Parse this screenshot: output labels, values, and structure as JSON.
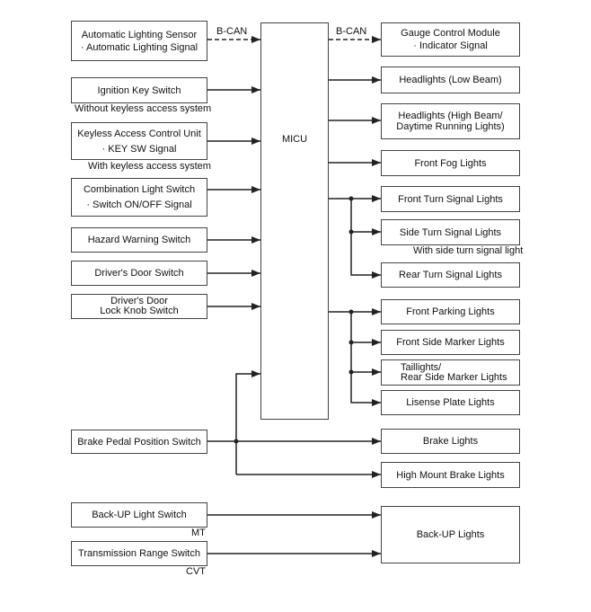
{
  "micu": "MICU",
  "bcan_in": "B-CAN",
  "bcan_out": "B-CAN",
  "inputs": {
    "auto_sensor": [
      "Automatic Lighting Sensor",
      "· Automatic Lighting Signal"
    ],
    "ignition": "Ignition Key Switch",
    "ignition_note": "Without keyless access system",
    "keyless": [
      "Keyless Access Control Unit",
      "· KEY SW Signal"
    ],
    "keyless_note": "With keyless access system",
    "combination": [
      "Combination Light Switch",
      "· Switch ON/OFF Signal"
    ],
    "hazard": "Hazard Warning Switch",
    "door": "Driver's Door Switch",
    "door_lock": [
      "Driver's Door",
      "Lock Knob Switch"
    ],
    "brake_pedal": "Brake Pedal Position Switch",
    "backup_switch": "Back-UP Light Switch",
    "backup_note": "MT",
    "trans_range": "Transmission Range Switch",
    "trans_note": "CVT"
  },
  "outputs": {
    "gauge": [
      "Gauge Control Module",
      "· Indicator Signal"
    ],
    "low_beam": "Headlights (Low Beam)",
    "high_beam": [
      "Headlights (High Beam/",
      "Daytime Running Lights)"
    ],
    "fog": "Front Fog Lights",
    "front_turn": "Front Turn Signal Lights",
    "side_turn": "Side Turn Signal Lights",
    "side_turn_note": "With side turn signal light",
    "rear_turn": "Rear Turn Signal Lights",
    "front_parking": "Front Parking Lights",
    "front_side_marker": "Front Side Marker Lights",
    "taillights": [
      "Taillights/",
      "Rear Side Marker Lights"
    ],
    "license": "Lisense Plate Lights",
    "brake": "Brake Lights",
    "high_mount": "High Mount Brake Lights",
    "backup": "Back-UP Lights"
  }
}
